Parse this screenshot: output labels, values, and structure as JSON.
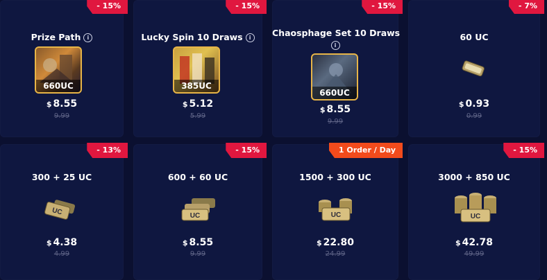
{
  "cards": [
    {
      "title": "Prize Path",
      "badge": "- 15%",
      "art_label": "660UC",
      "currency": "$",
      "price": "8.55",
      "old_price": "9.99"
    },
    {
      "title": "Lucky Spin 10 Draws",
      "badge": "- 15%",
      "art_label": "385UC",
      "currency": "$",
      "price": "5.12",
      "old_price": "5.99"
    },
    {
      "title": "Chaosphage Set 10 Draws",
      "badge": "- 15%",
      "art_label": "660UC",
      "currency": "$",
      "price": "8.55",
      "old_price": "9.99"
    },
    {
      "title": "60 UC",
      "badge": "- 7%",
      "currency": "$",
      "price": "0.93",
      "old_price": "0.99"
    },
    {
      "title": "300 + 25 UC",
      "badge": "- 13%",
      "currency": "$",
      "price": "4.38",
      "old_price": "4.99"
    },
    {
      "title": "600 + 60 UC",
      "badge": "- 15%",
      "currency": "$",
      "price": "8.55",
      "old_price": "9.99"
    },
    {
      "title": "1500 + 300 UC",
      "badge": "1 Order / Day",
      "currency": "$",
      "price": "22.80",
      "old_price": "24.99"
    },
    {
      "title": "3000 + 850 UC",
      "badge": "- 15%",
      "currency": "$",
      "price": "42.78",
      "old_price": "49.99"
    }
  ],
  "colors": {
    "background": "#0b1030",
    "card": "#0f1740",
    "badge_red": "#e0173f",
    "badge_orange": "#f24b1c",
    "art_border": "#e8b547",
    "old_price": "#5d6285"
  },
  "icons": [
    "info-icon",
    "uc-coin-icon"
  ]
}
